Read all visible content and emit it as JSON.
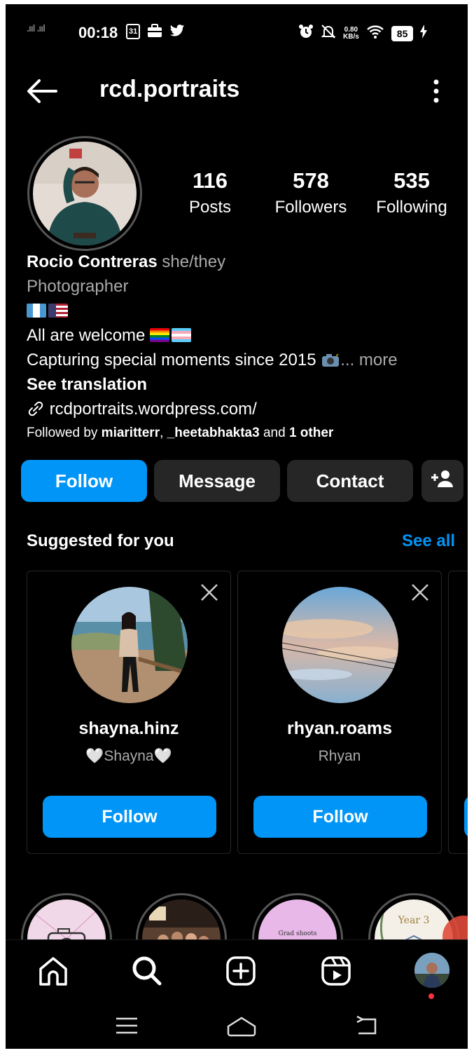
{
  "status": {
    "time": "00:18",
    "calendar_day": "31",
    "speed_value": "0.80",
    "speed_unit": "KB/s",
    "battery": "85"
  },
  "header": {
    "username": "rcd.portraits"
  },
  "stats": [
    {
      "value": "116",
      "label": "Posts"
    },
    {
      "value": "578",
      "label": "Followers"
    },
    {
      "value": "535",
      "label": "Following"
    }
  ],
  "bio": {
    "name": "Rocio Contreras",
    "pronouns": "she/they",
    "category": "Photographer",
    "line_welcome": "All are welcome",
    "line_capturing": "Capturing special moments since 2015",
    "more": "... more",
    "see_translation": "See translation",
    "link": "rcdportraits.wordpress.com/",
    "followed_prefix": "Followed by",
    "followed_user1": "miaritterr",
    "followed_sep": ",",
    "followed_user2": "_heetabhakta3",
    "followed_and": "and",
    "followed_other": "1 other"
  },
  "actions": {
    "follow": "Follow",
    "message": "Message",
    "contact": "Contact"
  },
  "suggested": {
    "title": "Suggested for you",
    "see_all": "See all",
    "cards": [
      {
        "username": "shayna.hinz",
        "display_name": "🤍Shayna🤍",
        "button": "Follow"
      },
      {
        "username": "rhyan.roams",
        "display_name": "Rhyan",
        "button": "Follow"
      }
    ]
  },
  "highlights": {
    "grad_text": "Grad shoots",
    "year_text": "Year 3"
  },
  "colors": {
    "accent": "#0095f6",
    "button_dark": "#262626",
    "background": "#000000",
    "notification": "#ff3040"
  },
  "icons": {
    "back": "arrow-left-icon",
    "menu": "more-vertical-icon",
    "link": "link-icon",
    "add_user": "add-user-icon",
    "close": "close-icon",
    "home": "home-icon",
    "search": "search-icon",
    "create": "plus-square-icon",
    "reels": "reels-icon"
  }
}
